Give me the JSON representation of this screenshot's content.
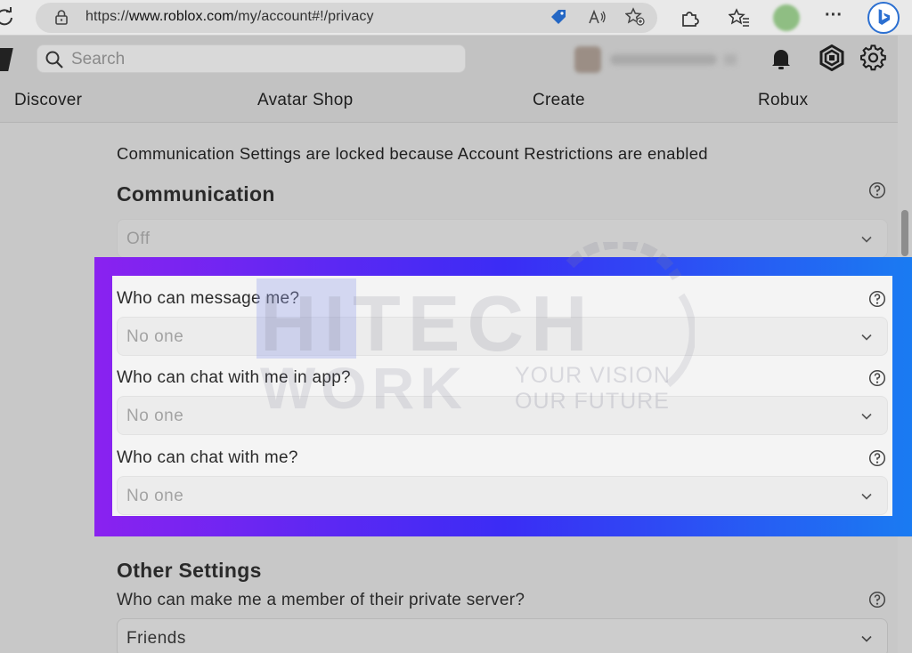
{
  "browser": {
    "url_prefix": "https://",
    "url_host": "www.roblox.com",
    "url_path": "/my/account#!/privacy",
    "more_label": "···"
  },
  "topnav": {
    "search_placeholder": "Search",
    "links": [
      "Discover",
      "Avatar Shop",
      "Create",
      "Robux"
    ]
  },
  "content": {
    "notice": "Communication Settings are locked because Account Restrictions are enabled",
    "communication": {
      "title": "Communication",
      "select_value": "Off"
    },
    "questions": [
      {
        "label": "Who can message me?",
        "value": "No one"
      },
      {
        "label": "Who can chat with me in app?",
        "value": "No one"
      },
      {
        "label": "Who can chat with me?",
        "value": "No one"
      }
    ],
    "other_settings": {
      "title": "Other Settings",
      "question": "Who can make me a member of their private server?",
      "value": "Friends"
    }
  },
  "watermark": {
    "line1": "HITECH",
    "line2": "WORK",
    "tagline1": "YOUR VISION",
    "tagline2": "OUR FUTURE"
  },
  "colors": {
    "frame_start": "#8a22f0",
    "frame_mid": "#3b2cf5",
    "frame_end": "#1a7bf2",
    "bing": "#2b6fd1"
  }
}
